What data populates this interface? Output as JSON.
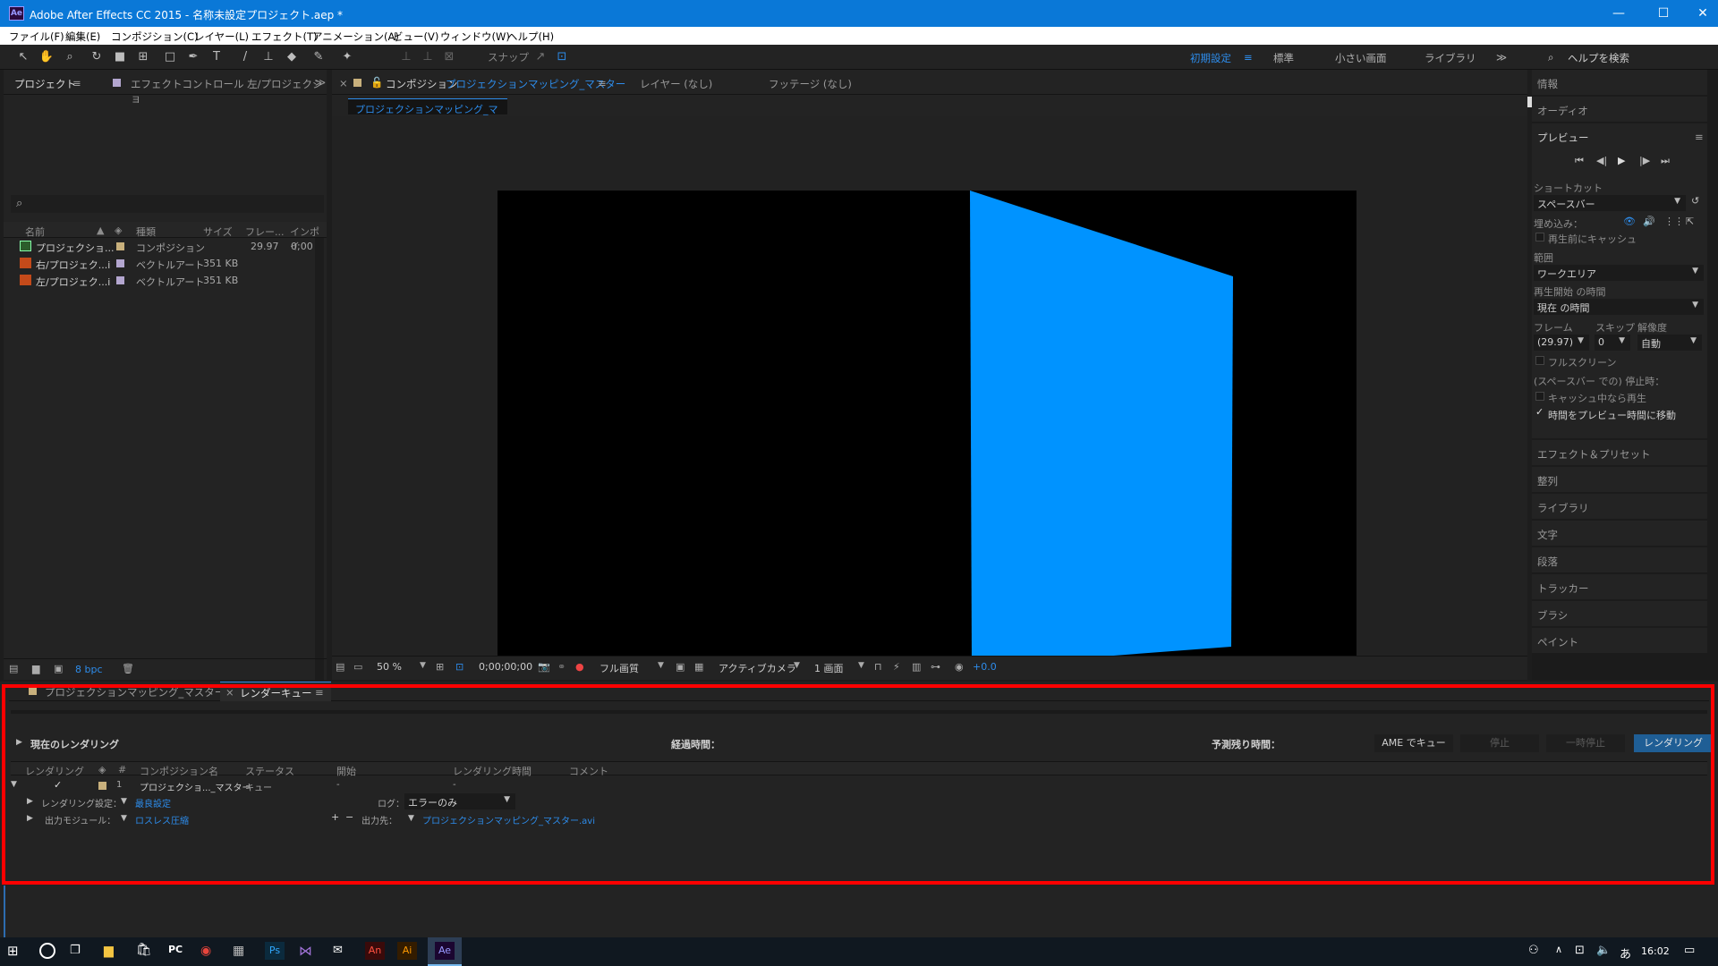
{
  "titlebar": {
    "app_logo": "Ae",
    "title": "Adobe After Effects CC 2015 - 名称未設定プロジェクト.aep *",
    "minimize": "—",
    "maximize": "☐",
    "close": "✕"
  },
  "menu": [
    "ファイル(F)",
    "編集(E)",
    "コンポジション(C)",
    "レイヤー(L)",
    "エフェクト(T)",
    "アニメーション(A)",
    "ビュー(V)",
    "ウィンドウ(W)",
    "ヘルプ(H)"
  ],
  "toolbar": {
    "snap_label": "スナップ",
    "workspaces": [
      "初期設定",
      "標準",
      "小さい画面",
      "ライブラリ"
    ],
    "more": "≫",
    "help_placeholder": "ヘルプを検索"
  },
  "project_panel": {
    "tab_project": "プロジェクト",
    "tab_effect": "エフェクトコントロール 左/プロジェクショ",
    "more": "≫",
    "search_icon": "⌕",
    "columns": [
      "名前",
      "種類",
      "サイズ",
      "フレー...",
      "インポイ"
    ],
    "rows": [
      {
        "name": "プロジェクショ...",
        "type": "コンポジション",
        "size": "",
        "fps": "29.97",
        "in": "0;00"
      },
      {
        "name": "右/プロジェク...i",
        "type": "ベクトルアート",
        "size": "351 KB",
        "fps": "",
        "in": ""
      },
      {
        "name": "左/プロジェク...i",
        "type": "ベクトルアート",
        "size": "351 KB",
        "fps": "",
        "in": ""
      }
    ],
    "bpc": "8 bpc"
  },
  "comp_panel": {
    "close": "×",
    "tab_comp_prefix": "コンポジション",
    "tab_comp_name": "プロジェクションマッピング_マスター",
    "tab_layer": "レイヤー (なし)",
    "tab_footage": "フッテージ (なし)",
    "breadcrumb": "プロジェクションマッピング_マスター",
    "zoom": "50 %",
    "timecode": "0;00;00;00",
    "quality": "フル画質",
    "camera": "アクティブカメラ",
    "views": "1 画面",
    "exposure": "+0.0"
  },
  "right_panel": {
    "info": "情報",
    "audio": "オーディオ",
    "preview": "プレビュー",
    "shortcut_label": "ショートカット",
    "shortcut_value": "スペースバー",
    "include_label": "埋め込み：",
    "cache_before": "再生前にキャッシュ",
    "range_label": "範囲",
    "range_value": "ワークエリア",
    "start_label": "再生開始 の時間",
    "start_value": "現在 の時間",
    "frame_label": "フレーム",
    "skip_label": "スキップ",
    "res_label": "解像度",
    "frame_value": "(29.97)",
    "skip_value": "0",
    "res_value": "自動",
    "fullscreen": "フルスクリーン",
    "stop_label": "(スペースバー での) 停止時：",
    "cache_play": "キャッシュ中なら再生",
    "move_time": "時間をプレビュー時間に移動",
    "panels": [
      "エフェクト＆プリセット",
      "整列",
      "ライブラリ",
      "文字",
      "段落",
      "トラッカー",
      "ブラシ",
      "ペイント"
    ]
  },
  "render_queue": {
    "tab_master": "プロジェクションマッピング_マスター",
    "tab_rq": "レンダーキュー",
    "current_render": "現在のレンダリング",
    "elapsed": "経過時間：",
    "remaining": "予測残り時間：",
    "btn_ame": "AME でキュー",
    "btn_stop": "停止",
    "btn_pause": "一時停止",
    "btn_render": "レンダリング",
    "columns": [
      "レンダリング",
      "#",
      "コンポジション名",
      "ステータス",
      "開始",
      "レンダリング時間",
      "コメント"
    ],
    "item": {
      "check": "✓",
      "num": "1",
      "name": "プロジェクショ..._マスター",
      "status": "キュー",
      "start": "-",
      "time": "-"
    },
    "render_settings_label": "レンダリング設定：",
    "render_settings_value": "最良設定",
    "log_label": "ログ：",
    "log_value": "エラーのみ",
    "output_module_label": "出力モジュール：",
    "output_module_value": "ロスレス圧縮",
    "output_to_label": "出力先：",
    "output_to_value": "プロジェクションマッピング_マスター.avi",
    "plus": "+",
    "minus": "−"
  },
  "taskbar": {
    "time": "16:02",
    "ime": "あ"
  },
  "colors": {
    "accent_blue": "#2d8ceb",
    "solid_blue": "#0093ff",
    "highlight_red": "#ff0000"
  }
}
